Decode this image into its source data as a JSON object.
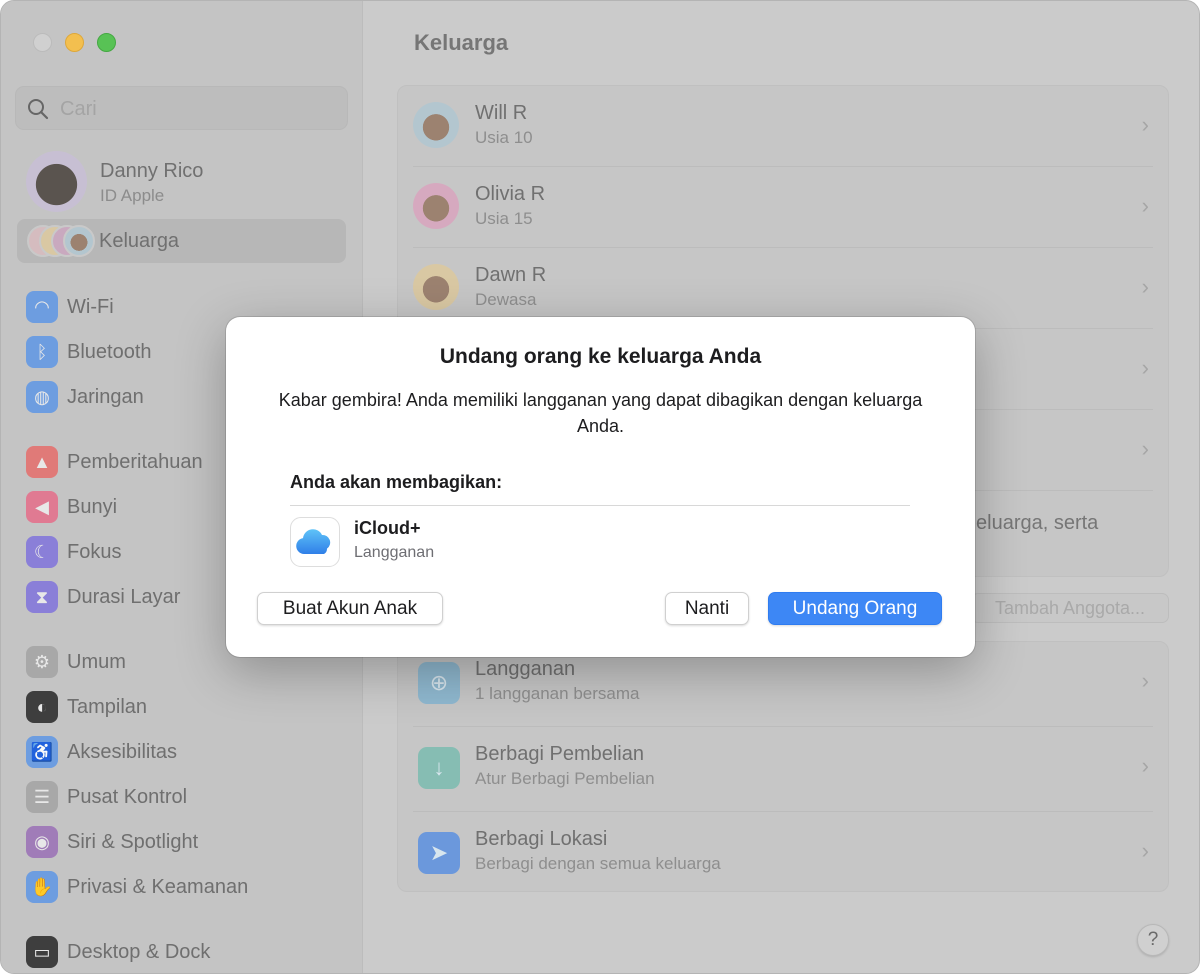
{
  "window": {
    "title": "Keluarga"
  },
  "sidebar": {
    "search_placeholder": "Cari",
    "account": {
      "name": "Danny Rico",
      "subtitle": "ID Apple"
    },
    "family_label": "Keluarga",
    "items": [
      {
        "label": "Wi-Fi",
        "icon": "wifi-icon",
        "color": "#6d9de0"
      },
      {
        "label": "Bluetooth",
        "icon": "bluetooth-icon",
        "color": "#6d9de0"
      },
      {
        "label": "Jaringan",
        "icon": "globe-icon",
        "color": "#6d9de0"
      },
      {
        "label": "Pemberitahuan",
        "icon": "bell-icon",
        "color": "#e07a78"
      },
      {
        "label": "Bunyi",
        "icon": "speaker-icon",
        "color": "#e07a92"
      },
      {
        "label": "Fokus",
        "icon": "moon-icon",
        "color": "#8a7fd8"
      },
      {
        "label": "Durasi Layar",
        "icon": "hourglass-icon",
        "color": "#8a7fd8"
      },
      {
        "label": "Umum",
        "icon": "gear-icon",
        "color": "#a8a8a8"
      },
      {
        "label": "Tampilan",
        "icon": "appearance-icon",
        "color": "#3e3e3e"
      },
      {
        "label": "Aksesibilitas",
        "icon": "accessibility-icon",
        "color": "#6d9de0"
      },
      {
        "label": "Pusat Kontrol",
        "icon": "control-center-icon",
        "color": "#a8a8a8"
      },
      {
        "label": "Siri & Spotlight",
        "icon": "siri-icon",
        "color": "#a07cb8"
      },
      {
        "label": "Privasi & Keamanan",
        "icon": "hand-icon",
        "color": "#6d9de0"
      },
      {
        "label": "Desktop & Dock",
        "icon": "dock-icon",
        "color": "#3e3e3e"
      }
    ]
  },
  "main": {
    "title": "Keluarga",
    "members": [
      {
        "name": "Will R",
        "detail": "Usia 10",
        "color": "#b3c6cf"
      },
      {
        "name": "Olivia R",
        "detail": "Usia 15",
        "color": "#d6a9bf"
      },
      {
        "name": "Dawn R",
        "detail": "Dewasa",
        "color": "#d9c8a3"
      }
    ],
    "partial_text": "eluarga, serta",
    "add_member_button": "Tambah Anggota...",
    "features": [
      {
        "title": "Langganan",
        "subtitle": "1 langganan bersama",
        "icon": "subscription-icon",
        "color": "#8fb8cf"
      },
      {
        "title": "Berbagi Pembelian",
        "subtitle": "Atur Berbagi Pembelian",
        "icon": "purchase-sharing-icon",
        "color": "#86bdb3"
      },
      {
        "title": "Berbagi Lokasi",
        "subtitle": "Berbagi dengan semua keluarga",
        "icon": "location-arrow-icon",
        "color": "#6b98dc"
      }
    ],
    "help": "?"
  },
  "dialog": {
    "title": "Undang orang ke keluarga Anda",
    "body": "Kabar gembira! Anda memiliki langganan yang dapat dibagikan dengan keluarga Anda.",
    "section_heading": "Anda akan membagikan:",
    "shared_item": {
      "name": "iCloud+",
      "type": "Langganan"
    },
    "buttons": {
      "child_account": "Buat Akun Anak",
      "later": "Nanti",
      "invite": "Undang Orang"
    },
    "accent": "#3d87f5"
  }
}
